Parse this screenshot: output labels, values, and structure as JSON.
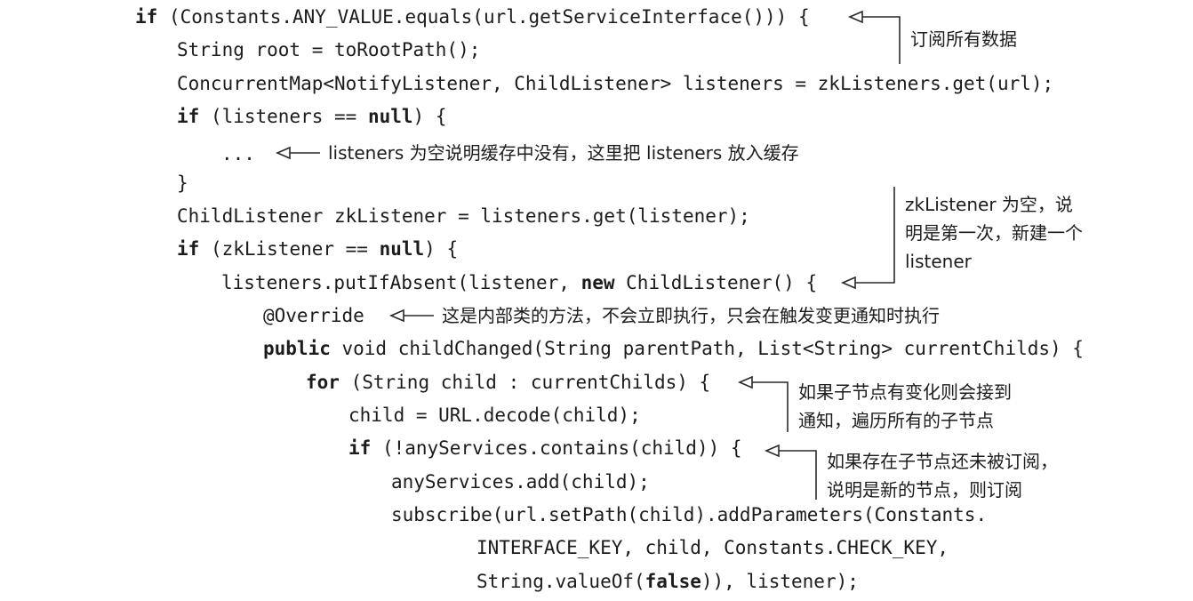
{
  "code": {
    "line01": {
      "kw": "if",
      "rest": " (Constants.ANY_VALUE.equals(url.getServiceInterface())) {"
    },
    "line02": {
      "text": "String root = toRootPath();"
    },
    "line03": {
      "text": "ConcurrentMap<NotifyListener, ChildListener> listeners = zkListeners.get(url);"
    },
    "line04": {
      "kw": "if",
      "mid": " (listeners == ",
      "kw2": "null",
      "rest": ") {"
    },
    "line05": {
      "text": "..."
    },
    "line06": {
      "text": "}"
    },
    "line07": {
      "text": "ChildListener zkListener = listeners.get(listener);"
    },
    "line08": {
      "kw": "if",
      "mid": " (zkListener == ",
      "kw2": "null",
      "rest": ") {"
    },
    "line09": {
      "pre": "listeners.putIfAbsent(listener, ",
      "kw": "new",
      "rest": " ChildListener() {"
    },
    "line10": {
      "text": "@Override"
    },
    "line11": {
      "kw": "public",
      "rest": " void childChanged(String parentPath, List<String> currentChilds) {"
    },
    "line12": {
      "kw": "for",
      "rest": " (String child : currentChilds) {"
    },
    "line13": {
      "text": "child = URL.decode(child);"
    },
    "line14": {
      "kw": "if",
      "rest": " (!anyServices.contains(child)) {"
    },
    "line15": {
      "text": "anyServices.add(child);"
    },
    "line16": {
      "text": "subscribe(url.setPath(child).addParameters(Constants."
    },
    "line17": {
      "text": "INTERFACE_KEY, child, Constants.CHECK_KEY,"
    },
    "line18": {
      "pre": "String.valueOf(",
      "kw": "false",
      "rest": ")), listener);"
    }
  },
  "annotations": {
    "subscribe_all": "订阅所有数据",
    "listeners_null": "listeners 为空说明缓存中没有，这里把 listeners 放入缓存",
    "zk_listener_null": [
      "zkListener 为空，说",
      "明是第一次，新建一个",
      "listener"
    ],
    "inner_class": "这是内部类的方法，不会立即执行，只会在触发变更通知时执行",
    "child_changed": [
      "如果子节点有变化则会接到",
      "通知，遍历所有的子节点"
    ],
    "not_subscribed": [
      "如果存在子节点还未被订阅，",
      "说明是新的节点，则订阅"
    ]
  }
}
